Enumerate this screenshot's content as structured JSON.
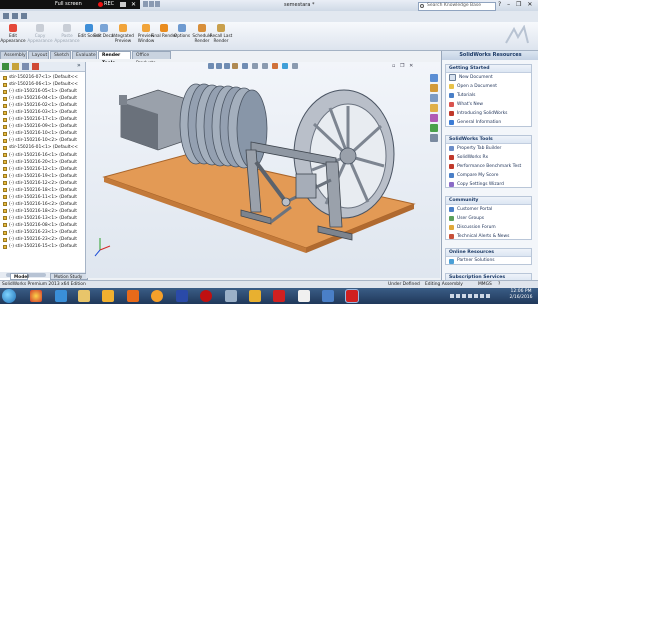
{
  "titlebar": {
    "title": "semestara *",
    "fullscreen_label": "Full screen",
    "rec_label": "REC",
    "search_placeholder": "Search Knowledge Base"
  },
  "ribbon": {
    "buttons": [
      {
        "label": "Edit Appearance",
        "icon": "edit-appearance-icon",
        "enabled": true
      },
      {
        "label": "Copy Appearance",
        "icon": "copy-appearance-icon",
        "enabled": false
      },
      {
        "label": "Paste Appearance",
        "icon": "paste-appearance-icon",
        "enabled": false
      },
      {
        "label": "Edit Scene",
        "icon": "edit-scene-icon",
        "enabled": true
      },
      {
        "label": "Edit Decal",
        "icon": "edit-decal-icon",
        "enabled": true
      },
      {
        "label": "Integrated Preview",
        "icon": "integrated-preview-icon",
        "enabled": true
      },
      {
        "label": "Preview Window",
        "icon": "preview-window-icon",
        "enabled": true
      },
      {
        "label": "Final Render",
        "icon": "final-render-icon",
        "enabled": true
      },
      {
        "label": "Options",
        "icon": "options-icon",
        "enabled": true
      },
      {
        "label": "Schedule Render",
        "icon": "schedule-render-icon",
        "enabled": true
      },
      {
        "label": "Recall Last Render",
        "icon": "recall-last-render-icon",
        "enabled": true
      }
    ]
  },
  "tabs": [
    {
      "label": "Assembly",
      "active": false
    },
    {
      "label": "Layout",
      "active": false
    },
    {
      "label": "Sketch",
      "active": false
    },
    {
      "label": "Evaluate",
      "active": false
    },
    {
      "label": "Render Tools",
      "active": true
    },
    {
      "label": "Office Products",
      "active": false
    }
  ],
  "tree": {
    "items": [
      "stir-150216-07<1> (Default<<",
      "stir-150216-06<1> (Default<<",
      "(-) stir-150216-05<1> (Default",
      "(-) stir-150216-04<1> (Default",
      "(-) stir-150216-02<1> (Default",
      "(-) stir-150216-03<1> (Default",
      "(-) stir-150216-17<1> (Default",
      "(-) stir-150216-09<1> (Default",
      "(-) stir-150216-10<1> (Default",
      "(-) stir-150216-10<2> (Default",
      "stir-150216-01<1> (Default<<",
      "(-) stir-150216-16<1> (Default",
      "(-) stir-150216-20<1> (Default",
      "(-) stir-150216-12<1> (Default",
      "(-) stir-150216-19<1> (Default",
      "(-) stir-150216-12<2> (Default",
      "(-) stir-150216-18<1> (Default",
      "(-) stir-150216-11<1> (Default",
      "(-) stir-150216-16<2> (Default",
      "(-) stir-150216-18<2> (Default",
      "(-) stir-150216-13<1> (Default",
      "(-) stir-150216-08<1> (Default",
      "(-) stir-150216-23<1> (Default",
      "(-) stir-150216-23<2> (Default",
      "(-) stir-150216-15<1> (Default"
    ]
  },
  "model_tabs": [
    {
      "label": "Model",
      "active": true
    },
    {
      "label": "Motion Study 1",
      "active": false
    }
  ],
  "resources": {
    "title": "SolidWorks Resources",
    "groups": [
      {
        "title": "Getting Started",
        "items": [
          "New Document",
          "Open a Document",
          "Tutorials",
          "What's New",
          "Introducing SolidWorks",
          "General Information"
        ]
      },
      {
        "title": "SolidWorks Tools",
        "items": [
          "Property Tab Builder",
          "SolidWorks Rx",
          "Performance Benchmark Test",
          "Compare My Score",
          "Copy Settings Wizard"
        ]
      },
      {
        "title": "Community",
        "items": [
          "Customer Portal",
          "User Groups",
          "Discussion Forum",
          "Technical Alerts & News"
        ]
      },
      {
        "title": "Online Resources",
        "items": [
          "Partner Solutions"
        ]
      },
      {
        "title": "Subscription Services",
        "items": []
      }
    ]
  },
  "status": {
    "edition": "SolidWorks Premium 2013 x64 Edition",
    "state": "Under Defined",
    "mode": "Editing Assembly",
    "units": "MMGS"
  },
  "clock": {
    "time": "12:06 PM",
    "date": "2/16/2016"
  },
  "colors": {
    "base_plate": "#e39a55",
    "cylinder_fins": "#8a97a8",
    "metal": "#b9bfc9",
    "taskbar": "#20385a"
  }
}
